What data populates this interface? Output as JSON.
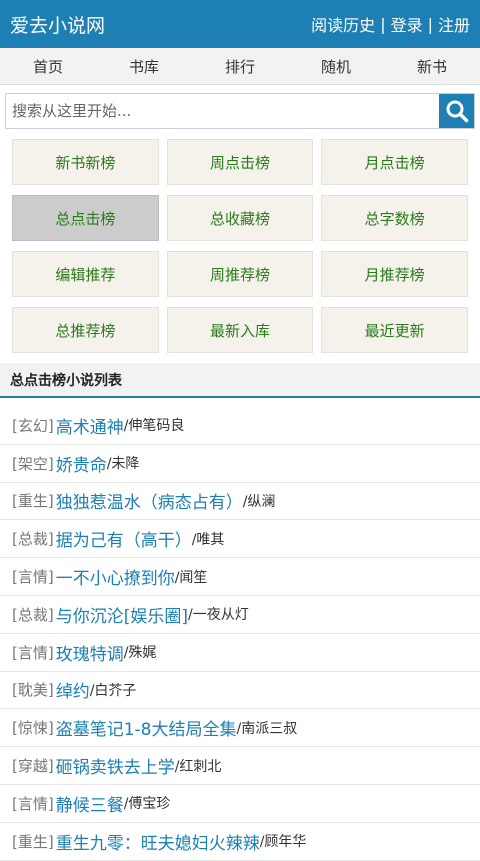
{
  "header": {
    "site_title": "爱去小说网",
    "history": "阅读历史",
    "login": "登录",
    "register": "注册",
    "separator": "|"
  },
  "nav": [
    "首页",
    "书库",
    "排行",
    "随机",
    "新书"
  ],
  "search": {
    "placeholder": "搜索从这里开始...",
    "value": ""
  },
  "rank_buttons": [
    "新书新榜",
    "周点击榜",
    "月点击榜",
    "总点击榜",
    "总收藏榜",
    "总字数榜",
    "编辑推荐",
    "周推荐榜",
    "月推荐榜",
    "总推荐榜",
    "最新入库",
    "最近更新"
  ],
  "active_rank": "总点击榜",
  "list_title": "总点击榜小说列表",
  "books": [
    {
      "category": "[玄幻]",
      "title": "高术通神",
      "author": "/伸笔码良"
    },
    {
      "category": "[架空]",
      "title": "娇贵命",
      "author": "/未降"
    },
    {
      "category": "[重生]",
      "title": "独独惹温水（病态占有）",
      "author": "/纵澜"
    },
    {
      "category": "[总裁]",
      "title": "据为己有（高干）",
      "author": "/唯其"
    },
    {
      "category": "[言情]",
      "title": "一不小心撩到你",
      "author": "/闻笙"
    },
    {
      "category": "[总裁]",
      "title": "与你沉沦[娱乐圈]",
      "author": "/一夜从灯"
    },
    {
      "category": "[言情]",
      "title": "玫瑰特调",
      "author": "/殊娓"
    },
    {
      "category": "[耽美]",
      "title": "绰约",
      "author": "/白芥子"
    },
    {
      "category": "[惊悚]",
      "title": "盗墓笔记1-8大结局全集",
      "author": "/南派三叔"
    },
    {
      "category": "[穿越]",
      "title": "砸锅卖铁去上学",
      "author": "/红刺北"
    },
    {
      "category": "[言情]",
      "title": "静候三餐",
      "author": "/傅宝珍"
    },
    {
      "category": "[重生]",
      "title": "重生九零：旺夫媳妇火辣辣",
      "author": "/顾年华"
    }
  ],
  "colors": {
    "brand": "#1d7fb3",
    "rank_text": "#2a7a1c",
    "active_rank_bg": "#cccccc"
  }
}
